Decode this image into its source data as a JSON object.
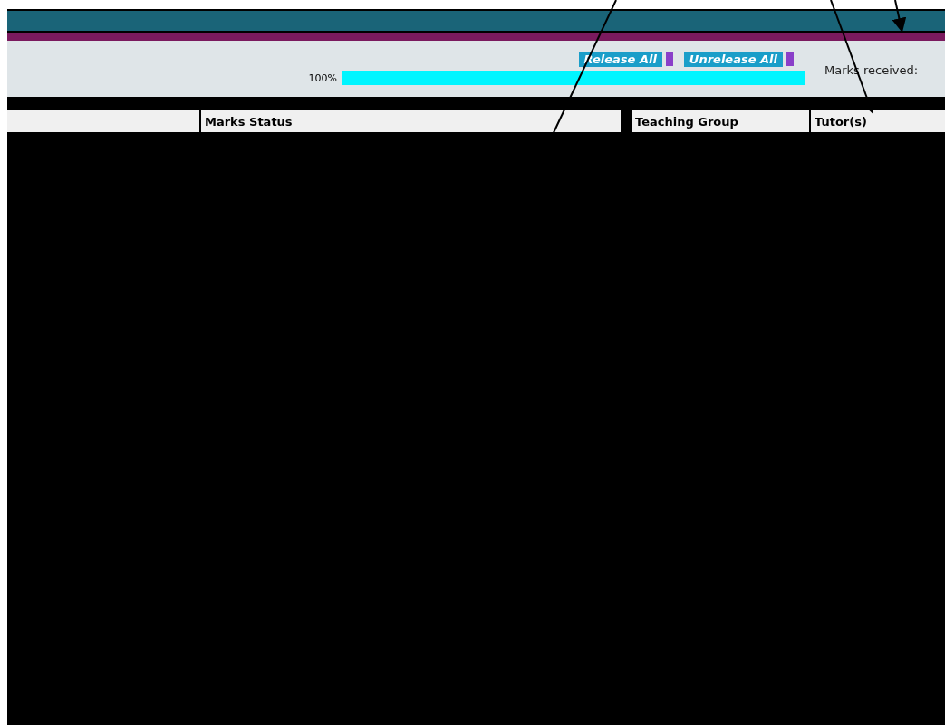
{
  "toolbar": {
    "buttons": [
      {
        "label": "Release All"
      },
      {
        "label": "Unrelease All"
      }
    ]
  },
  "progress": {
    "reading": "100%",
    "level": 1
  },
  "summary": {
    "label": "Marks received:"
  },
  "table": {
    "columns": [
      "",
      "Marks Status",
      "Teaching Group",
      "Tutor(s)"
    ]
  }
}
